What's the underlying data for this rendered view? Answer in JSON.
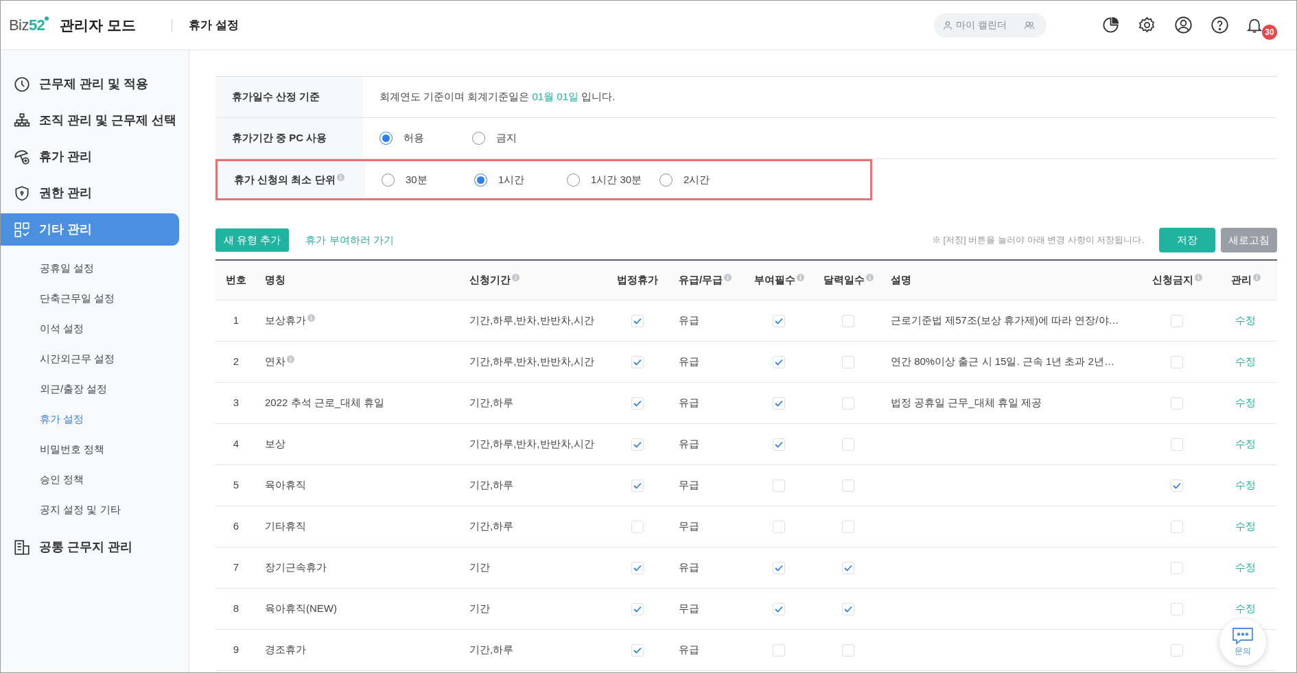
{
  "header": {
    "logo": {
      "part_1": "Biz",
      "part_2": "52"
    },
    "title": "관리자 모드",
    "page_title": "휴가 설정",
    "calendar_button": "마이 캘린더",
    "notification_count": "30"
  },
  "sidebar": {
    "items": [
      {
        "label": "근무제 관리 및 적용",
        "selected": false
      },
      {
        "label": "조직 관리 및 근무제 선택",
        "selected": false
      },
      {
        "label": "휴가 관리",
        "selected": false
      },
      {
        "label": "권한 관리",
        "selected": false
      },
      {
        "label": "기타 관리",
        "selected": true,
        "children": [
          {
            "label": "공휴일 설정",
            "selected": false
          },
          {
            "label": "단축근무일 설정",
            "selected": false
          },
          {
            "label": "이석 설정",
            "selected": false
          },
          {
            "label": "시간외근무 설정",
            "selected": false
          },
          {
            "label": "외근/출장 설정",
            "selected": false
          },
          {
            "label": "휴가 설정",
            "selected": true
          },
          {
            "label": "비밀번호 정책",
            "selected": false
          },
          {
            "label": "승인 정책",
            "selected": false
          },
          {
            "label": "공지 설정 및 기타",
            "selected": false
          }
        ]
      },
      {
        "label": "공통 근무지 관리",
        "selected": false
      }
    ]
  },
  "settings": [
    {
      "kind": "text",
      "label": "휴가일수 산정 기준",
      "info": false,
      "highlighted": false,
      "parts": [
        {
          "text": "회계연도 기준이며 회계기준일은 ",
          "highlight": false
        },
        {
          "text": "01월 01일",
          "highlight": true
        },
        {
          "text": " 입니다.",
          "highlight": false
        }
      ]
    },
    {
      "kind": "radio",
      "label": "휴가기간 중 PC 사용",
      "info": false,
      "highlighted": false,
      "options": [
        {
          "label": "허용",
          "selected": true
        },
        {
          "label": "금지",
          "selected": false
        }
      ]
    },
    {
      "kind": "radio",
      "label": "휴가 신청의 최소 단위",
      "info": true,
      "highlighted": true,
      "options": [
        {
          "label": "30분",
          "selected": false
        },
        {
          "label": "1시간",
          "selected": true
        },
        {
          "label": "1시간 30분",
          "selected": false
        },
        {
          "label": "2시간",
          "selected": false
        }
      ]
    }
  ],
  "toolbar": {
    "add_button": "새 유형 추가",
    "grant_link": "휴가 부여하러 가기",
    "notice": "※ [저장] 버튼을 눌러야 아래 변경 사항이 저장됩니다.",
    "save_button": "저장",
    "refresh_button": "새로고침"
  },
  "table": {
    "columns": [
      {
        "label": "번호",
        "info": false
      },
      {
        "label": "명칭",
        "info": false
      },
      {
        "label": "신청기간",
        "info": true
      },
      {
        "label": "법정휴가",
        "info": false
      },
      {
        "label": "유급/무급",
        "info": true
      },
      {
        "label": "부여필수",
        "info": true
      },
      {
        "label": "달력일수",
        "info": true
      },
      {
        "label": "설명",
        "info": false
      },
      {
        "label": "신청금지",
        "info": true
      },
      {
        "label": "관리",
        "info": true
      }
    ],
    "rows": [
      {
        "no": "1",
        "name": "보상휴가",
        "name_info": true,
        "period": "기간,하루,반차,반반차,시간",
        "statutory": true,
        "pay": "유급",
        "grant_required": true,
        "calendar_days": false,
        "description": "근로기준법 제57조(보상 휴가제)에 따라 연장/야…",
        "prohibited": false,
        "action": "수정"
      },
      {
        "no": "2",
        "name": "연차",
        "name_info": true,
        "period": "기간,하루,반차,반반차,시간",
        "statutory": true,
        "pay": "유급",
        "grant_required": true,
        "calendar_days": false,
        "description": "연간 80%이상 출근 시 15일. 근속 1년 초과 2년…",
        "prohibited": false,
        "action": "수정"
      },
      {
        "no": "3",
        "name": "2022 추석 근로_대체 휴일",
        "name_info": false,
        "period": "기간,하루",
        "statutory": true,
        "pay": "유급",
        "grant_required": true,
        "calendar_days": false,
        "description": "법정 공휴일 근무_대체 휴일 제공",
        "prohibited": false,
        "action": "수정"
      },
      {
        "no": "4",
        "name": "보상",
        "name_info": false,
        "period": "기간,하루,반차,반반차,시간",
        "statutory": true,
        "pay": "유급",
        "grant_required": true,
        "calendar_days": false,
        "prohibited": false,
        "action": "수정"
      },
      {
        "no": "5",
        "name": "육아휴직",
        "name_info": false,
        "period": "기간,하루",
        "statutory": true,
        "pay": "무급",
        "grant_required": false,
        "calendar_days": false,
        "prohibited": true,
        "action": "수정"
      },
      {
        "no": "6",
        "name": "기타휴직",
        "name_info": false,
        "period": "기간,하루",
        "statutory": false,
        "pay": "무급",
        "grant_required": false,
        "calendar_days": false,
        "prohibited": false,
        "action": "수정"
      },
      {
        "no": "7",
        "name": "장기근속휴가",
        "name_info": false,
        "period": "기간",
        "statutory": true,
        "pay": "유급",
        "grant_required": true,
        "calendar_days": true,
        "prohibited": false,
        "action": "수정"
      },
      {
        "no": "8",
        "name": "육아휴직(NEW)",
        "name_info": false,
        "period": "기간",
        "statutory": true,
        "pay": "무급",
        "grant_required": true,
        "calendar_days": true,
        "prohibited": false,
        "action": "수정"
      },
      {
        "no": "9",
        "name": "경조휴가",
        "name_info": false,
        "period": "기간,하루",
        "statutory": true,
        "pay": "유급",
        "grant_required": false,
        "calendar_days": false,
        "prohibited": false
      }
    ]
  },
  "chat_button": {
    "label": "문의"
  }
}
